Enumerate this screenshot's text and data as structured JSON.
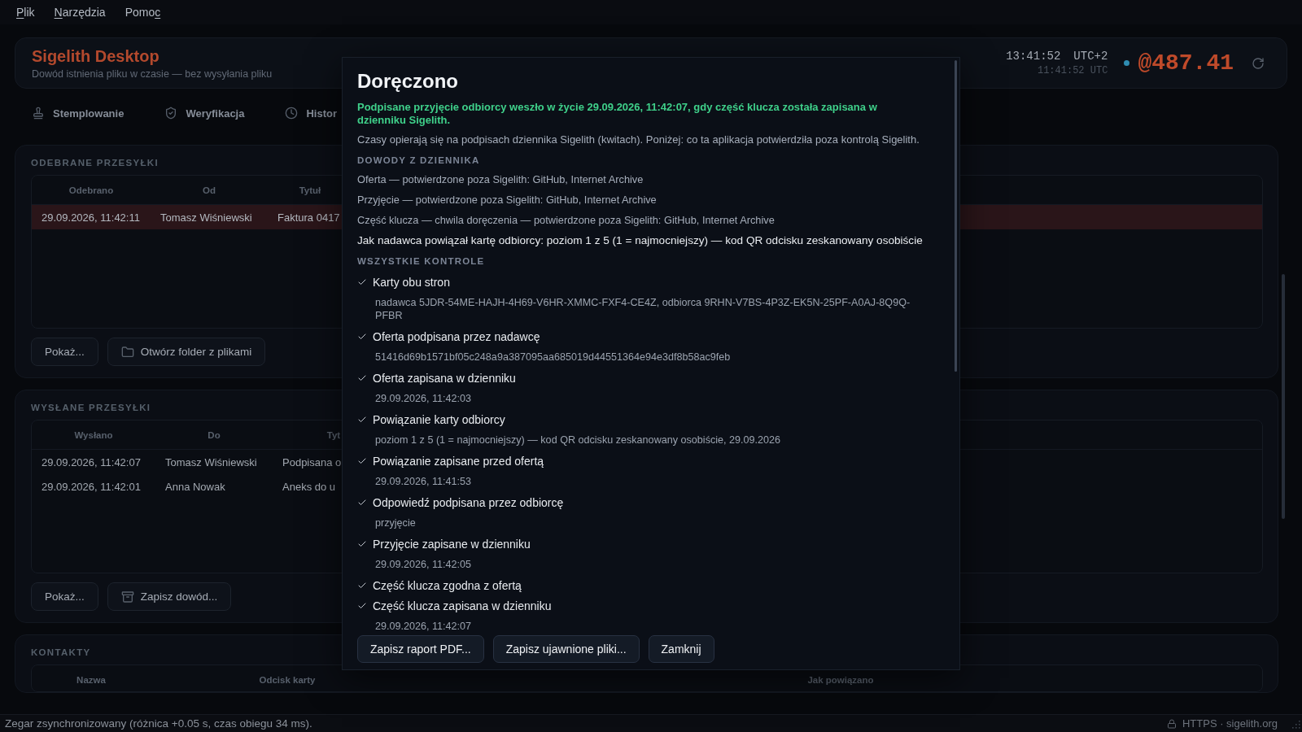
{
  "menu": [
    {
      "key": "P",
      "after": "lik"
    },
    {
      "key": "N",
      "after": "arzędzia"
    },
    {
      "before": "Pomo",
      "key": "c"
    }
  ],
  "header": {
    "title": "Sigelith Desktop",
    "subtitle": "Dowód istnienia pliku w czasie — bez wysyłania pliku",
    "local_time": "13:41:52",
    "zone": "UTC+2",
    "utc_time": "11:41:52 UTC",
    "counter": "@487.41"
  },
  "tabs": [
    {
      "label": "Stemplowanie",
      "selected": false
    },
    {
      "label": "Weryfikacja",
      "selected": false
    },
    {
      "label": "Histor",
      "selected": false
    }
  ],
  "panels": [
    {
      "title": "ODEBRANE PRZESYŁKI",
      "columns": [
        "Odebrano",
        "Od",
        "Tytuł"
      ],
      "rows": [
        {
          "cells": [
            "29.09.2026, 11:42:11",
            "Tomasz Wiśniewski",
            "Faktura 0417"
          ],
          "selected": true
        }
      ],
      "buttons": [
        "Pokaż...",
        "Otwórz folder z plikami"
      ]
    },
    {
      "title": "WYSŁANE PRZESYŁKI",
      "columns": [
        "Wysłano",
        "Do",
        "Tyt"
      ],
      "rows": [
        {
          "cells": [
            "29.09.2026, 11:42:07",
            "Tomasz Wiśniewski",
            "Podpisana o"
          ],
          "selected": false
        },
        {
          "cells": [
            "29.09.2026, 11:42:01",
            "Anna Nowak",
            "Aneks do u"
          ],
          "selected": false
        }
      ],
      "buttons": [
        "Pokaż...",
        "Zapisz dowód..."
      ]
    },
    {
      "title": "KONTAKTY",
      "columns": [
        "Nazwa",
        "Odcisk karty",
        "Jak powiązano"
      ]
    }
  ],
  "dialog": {
    "title": "Doręczono",
    "summary": "Podpisane przyjęcie odbiorcy weszło w życie 29.09.2026, 11:42:07, gdy część klucza została zapisana w dzienniku Sigelith.",
    "note": "Czasy opierają się na podpisach dziennika Sigelith (kwitach). Poniżej: co ta aplikacja potwierdziła poza kontrolą Sigelith.",
    "evidence_heading": "DOWODY Z DZIENNIKA",
    "evidence": [
      "Oferta — potwierdzone poza Sigelith: GitHub, Internet Archive",
      "Przyjęcie — potwierdzone poza Sigelith: GitHub, Internet Archive",
      "Część klucza — chwila doręczenia — potwierdzone poza Sigelith: GitHub, Internet Archive"
    ],
    "binding": "Jak nadawca powiązał kartę odbiorcy: poziom 1 z 5 (1 = najmocniejszy) — kod QR odcisku zeskanowany osobiście",
    "checks_heading": "WSZYSTKIE KONTROLE",
    "checks": [
      {
        "title": "Karty obu stron",
        "detail": "nadawca 5JDR-54ME-HAJH-4H69-V6HR-XMMC-FXF4-CE4Z, odbiorca 9RHN-V7BS-4P3Z-EK5N-25PF-A0AJ-8Q9Q-PFBR",
        "passed": true
      },
      {
        "title": "Oferta podpisana przez nadawcę",
        "detail": "51416d69b1571bf05c248a9a387095aa685019d44551364e94e3df8b58ac9feb",
        "passed": true
      },
      {
        "title": "Oferta zapisana w dzienniku",
        "detail": "29.09.2026, 11:42:03",
        "passed": true
      },
      {
        "title": "Powiązanie karty odbiorcy",
        "detail": "poziom 1 z 5 (1 = najmocniejszy) — kod QR odcisku zeskanowany osobiście, 29.09.2026",
        "passed": true
      },
      {
        "title": "Powiązanie zapisane przed ofertą",
        "detail": "29.09.2026, 11:41:53",
        "passed": true
      },
      {
        "title": "Odpowiedź podpisana przez odbiorcę",
        "detail": "przyjęcie",
        "passed": true
      },
      {
        "title": "Przyjęcie zapisane w dzienniku",
        "detail": "29.09.2026, 11:42:05",
        "passed": true
      },
      {
        "title": "Część klucza zgodna z ofertą",
        "passed": true
      },
      {
        "title": "Część klucza zapisana w dzienniku",
        "detail": "29.09.2026, 11:42:07",
        "passed": true
      }
    ],
    "buttons": [
      "Zapisz raport PDF...",
      "Zapisz ujawnione pliki...",
      "Zamknij"
    ]
  },
  "status_bar": {
    "message": "Zegar zsynchronizowany (różnica +0.05 s, czas obiegu 34 ms).",
    "connection": "HTTPS · sigelith.org"
  }
}
